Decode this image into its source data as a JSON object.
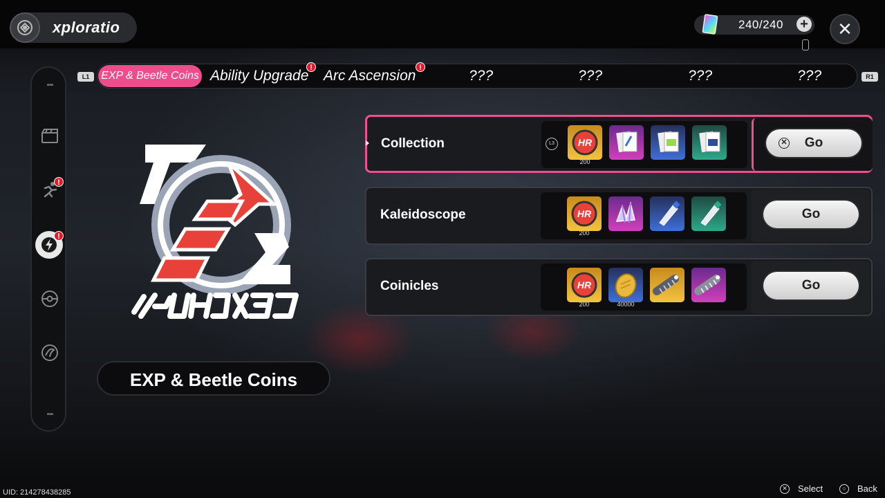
{
  "header": {
    "title": "xploratio",
    "currency_value": "240/240",
    "add_label": "+",
    "close_label": "✕"
  },
  "tabs": {
    "left_shoulder": "L1",
    "right_shoulder": "R1",
    "items": [
      {
        "label": "EXP & Beetle Coins",
        "active": true,
        "alert": false
      },
      {
        "label": "Ability Upgrade",
        "active": false,
        "alert": true
      },
      {
        "label": "Arc Ascension",
        "active": false,
        "alert": true
      },
      {
        "label": "???",
        "active": false,
        "alert": false
      },
      {
        "label": "???",
        "active": false,
        "alert": false
      },
      {
        "label": "???",
        "active": false,
        "alert": false
      },
      {
        "label": "???",
        "active": false,
        "alert": false
      }
    ]
  },
  "alert_mark": "!",
  "sidebar": {
    "items": [
      {
        "icon": "clapperboard-icon",
        "alert": false,
        "active": false
      },
      {
        "icon": "runner-icon",
        "alert": true,
        "active": false
      },
      {
        "icon": "lightning-icon",
        "alert": true,
        "active": true
      },
      {
        "icon": "capsule-ball-icon",
        "alert": false,
        "active": false
      },
      {
        "icon": "swirl-target-icon",
        "alert": false,
        "active": false
      }
    ]
  },
  "selected_mode": "EXP & Beetle Coins",
  "missions": [
    {
      "name": "Collection",
      "selected": true,
      "rewards": [
        {
          "icon": "hunter-badge-icon",
          "tier": "gold",
          "qty": "200"
        },
        {
          "icon": "card-pack-icon",
          "tier": "purple",
          "qty": ""
        },
        {
          "icon": "card-pack-icon",
          "tier": "blue",
          "qty": ""
        },
        {
          "icon": "card-pack-icon",
          "tier": "green",
          "qty": ""
        }
      ],
      "go_label": "Go"
    },
    {
      "name": "Kaleidoscope",
      "selected": false,
      "rewards": [
        {
          "icon": "hunter-badge-icon",
          "tier": "gold",
          "qty": "200"
        },
        {
          "icon": "crystal-cluster-icon",
          "tier": "purple",
          "qty": ""
        },
        {
          "icon": "paint-tube-icon",
          "tier": "blue",
          "qty": ""
        },
        {
          "icon": "paint-tube-icon",
          "tier": "green",
          "qty": ""
        }
      ],
      "go_label": "Go"
    },
    {
      "name": "Coinicles",
      "selected": false,
      "rewards": [
        {
          "icon": "hunter-badge-icon",
          "tier": "gold",
          "qty": "200"
        },
        {
          "icon": "golden-egg-icon",
          "tier": "blue",
          "qty": "40000"
        },
        {
          "icon": "spring-coil-icon",
          "tier": "gold",
          "qty": ""
        },
        {
          "icon": "spring-coil-icon",
          "tier": "purple",
          "qty": ""
        }
      ],
      "go_label": "Go"
    }
  ],
  "l3_label": "L3",
  "go_cross": "✕",
  "footer": {
    "uid": "UID: 214278438285",
    "select_label": "Select",
    "back_label": "Back",
    "select_glyph": "✕",
    "back_glyph": "○"
  },
  "colors": {
    "accent_pink": "#ee4d8c",
    "alert_red": "#e01b2a",
    "logo_red": "#e8413a"
  }
}
